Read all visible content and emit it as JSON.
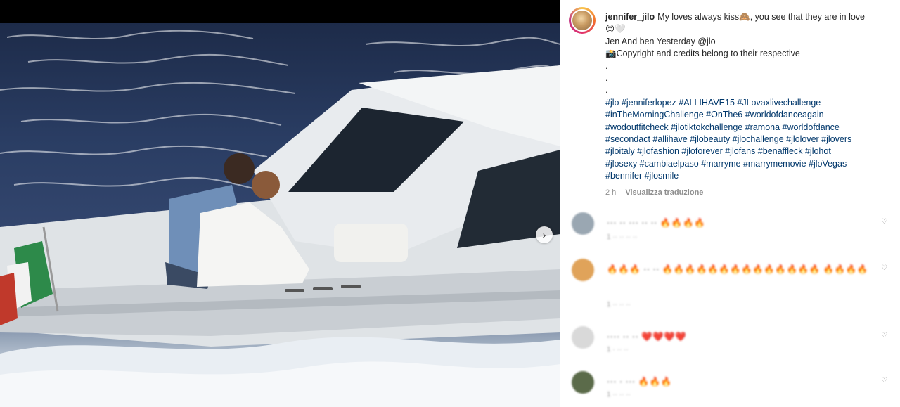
{
  "post": {
    "username": "jennifer_jilo",
    "caption_lines": [
      "My loves always kiss🙈, you see that they are in love",
      "😍🤍",
      "Jen And ben Yesterday @jlo",
      "📸Copyright and credits belong to their respective",
      ".",
      ".",
      "."
    ],
    "hashtag_lines": [
      "#jlo #jenniferlopez #ALLIHAVE15 #JLovaxlivechallenge",
      "#inTheMorningChallenge #OnThe6 #worldofdanceagain",
      "#wodoutfitcheck #jlotiktokchallenge #ramona #worldofdance",
      "#secondact #allihave #jlobeauty #jlochallenge #jlolover #jlovers",
      "#jloitaly #jlofashion #jloforever #jlofans #benaffleck #jlohot",
      "#jlosexy #cambiaelpaso #marryme #marrymemovie #jloVegas",
      "#bennifer #jlosmile"
    ],
    "time_ago": "2 h",
    "translate_label": "Visualizza traduzione"
  },
  "media": {
    "next_icon": "chevron-right-icon",
    "next_glyph": "›"
  },
  "comments": [
    {
      "text": "··· ·· ··· ·· ·· 🔥🔥🔥🔥",
      "meta": "1 ·· ·· ·· ··",
      "avatar_color": "#9aa7b2"
    },
    {
      "text": "🔥🔥🔥 ·· ·· 🔥🔥🔥🔥🔥🔥🔥🔥🔥🔥🔥🔥🔥🔥 🔥🔥🔥🔥",
      "meta": "1 ·· ·· ··",
      "avatar_color": "#e0a35a"
    },
    {
      "text": "···· ·· ·· ❤️❤️❤️❤️",
      "meta": "1 · ·· ··",
      "avatar_color": "#d9d9d9"
    },
    {
      "text": "··· · ··· 🔥🔥🔥",
      "meta": "1 ·· ·· ··",
      "avatar_color": "#5b6b4a"
    }
  ],
  "heart_icon": "♡",
  "colors": {
    "hashtag": "#00376b",
    "text": "#262626",
    "muted": "#8e8e8e"
  }
}
